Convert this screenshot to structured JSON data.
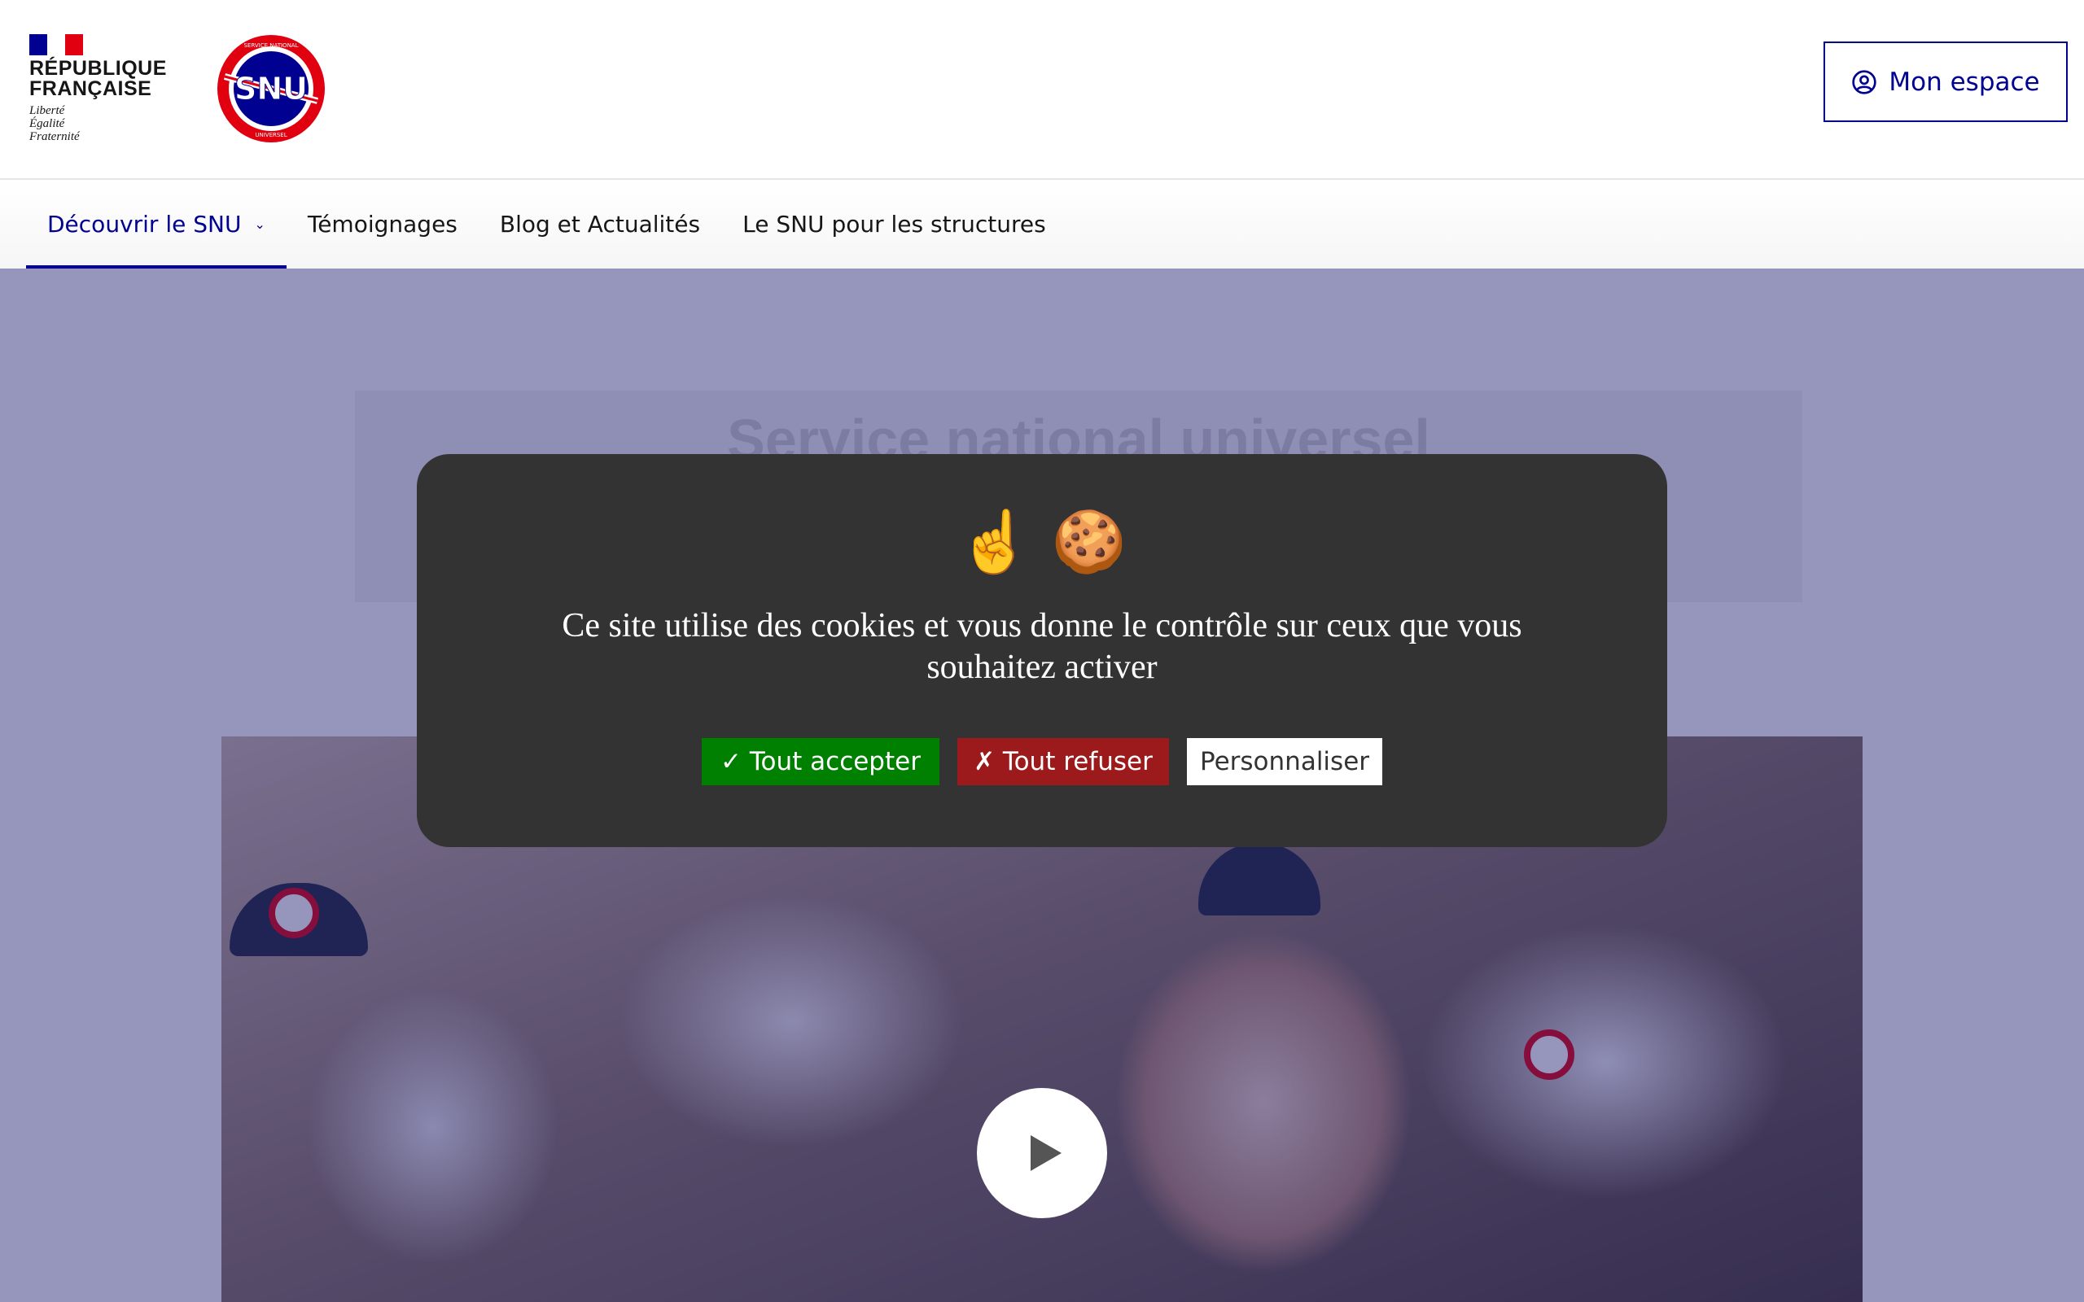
{
  "header": {
    "marianne": {
      "title_line1": "RÉPUBLIQUE",
      "title_line2": "FRANÇAISE",
      "devise_1": "Liberté",
      "devise_2": "Égalité",
      "devise_3": "Fraternité"
    },
    "snu_logo": {
      "text": "SNU",
      "ring_top": "SERVICE NATIONAL",
      "ring_bottom": "UNIVERSEL"
    },
    "account_button": {
      "label": "Mon espace",
      "icon": "user-circle-icon"
    }
  },
  "nav": {
    "items": [
      {
        "label": "Découvrir le SNU",
        "active": true,
        "has_dropdown": true
      },
      {
        "label": "Témoignages"
      },
      {
        "label": "Blog et Actualités"
      },
      {
        "label": "Le SNU pour les structures"
      }
    ]
  },
  "hero": {
    "title": "Service national universel",
    "video_play_icon": "play-icon"
  },
  "cookie_banner": {
    "emoji": "☝️ 🍪",
    "message": "Ce site utilise des cookies et vous donne le contrôle sur ceux que vous souhaitez activer",
    "accept_label": "✓ Tout accepter",
    "refuse_label": "✗ Tout refuser",
    "customize_label": "Personnaliser"
  },
  "colors": {
    "primary": "#000091",
    "accept": "#008000",
    "refuse": "#9c1a1c",
    "modal_bg": "#333333",
    "overlay": "#201e70"
  }
}
